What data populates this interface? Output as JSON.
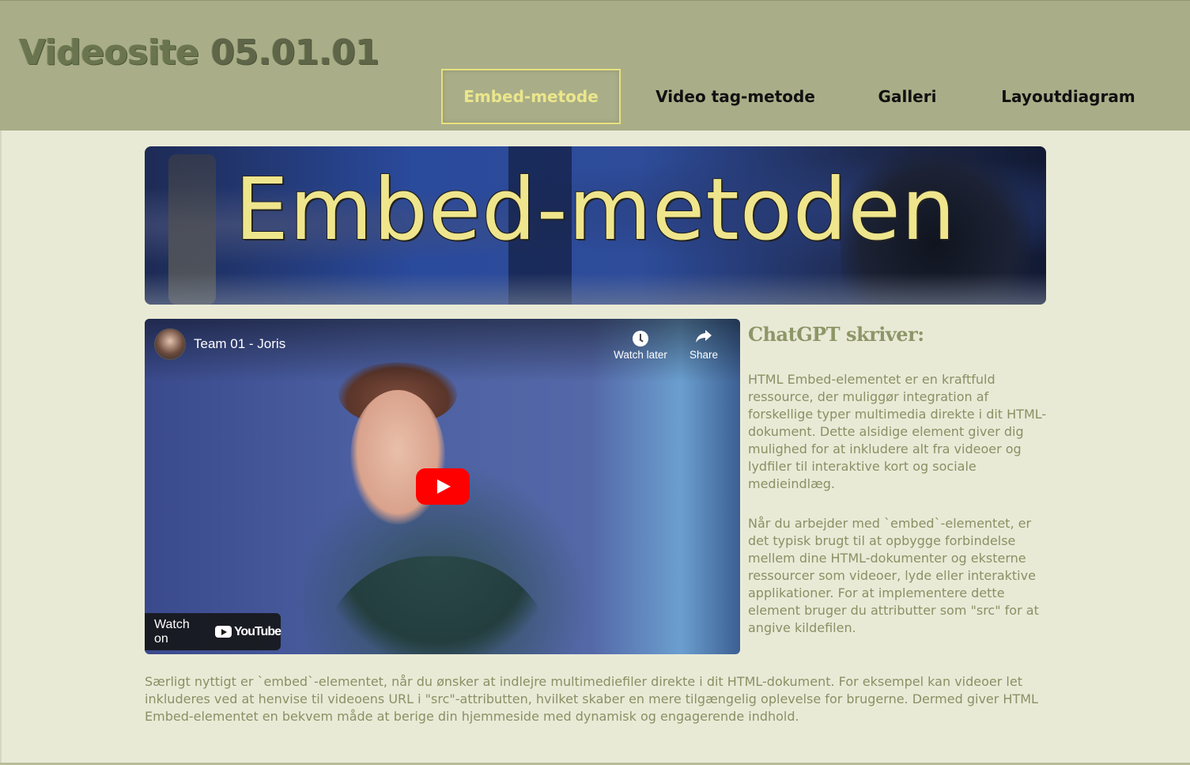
{
  "header": {
    "site_title_main": "Videosite",
    "site_title_version": "05.01.01"
  },
  "nav": {
    "items": [
      {
        "label": "Embed-metode",
        "active": true
      },
      {
        "label": "Video tag-metode",
        "active": false
      },
      {
        "label": "Galleri",
        "active": false
      },
      {
        "label": "Layoutdiagram",
        "active": false
      }
    ]
  },
  "hero": {
    "title": "Embed-metoden"
  },
  "video": {
    "channel_title": "Team 01 - Joris",
    "watch_later_label": "Watch later",
    "share_label": "Share",
    "watch_on_label": "Watch on",
    "youtube_label": "YouTube"
  },
  "side": {
    "heading": "ChatGPT skriver:",
    "paragraph1": "HTML Embed-elementet er en kraftfuld ressource, der muliggør integration af forskellige typer multimedia direkte i dit HTML-dokument. Dette alsidige element giver dig mulighed for at inkludere alt fra videoer og lydfiler til interaktive kort og sociale medieindlæg.",
    "paragraph2": "Når du arbejder med `embed`-elementet, er det typisk brugt til at opbygge forbindelse mellem dine HTML-dokumenter og eksterne ressourcer som videoer, lyde eller interaktive applikationer. For at implementere dette element bruger du attributter som \"src\" for at angive kildefilen."
  },
  "bottom": {
    "paragraph": "Særligt nyttigt er `embed`-elementet, når du ønsker at indlejre multimediefiler direkte i dit HTML-dokument. For eksempel kan videoer let inkluderes ved at henvise til videoens URL i \"src\"-attributten, hvilket skaber en mere tilgængelig oplevelse for brugerne. Dermed giver HTML Embed-elementet en bekvem måde at berige din hjemmeside med dynamisk og engagerende indhold."
  },
  "colors": {
    "header_bg": "#a9ae88",
    "page_bg": "#e9ead6",
    "accent_yellow": "#efe58c",
    "text_olive": "#8a9064"
  }
}
